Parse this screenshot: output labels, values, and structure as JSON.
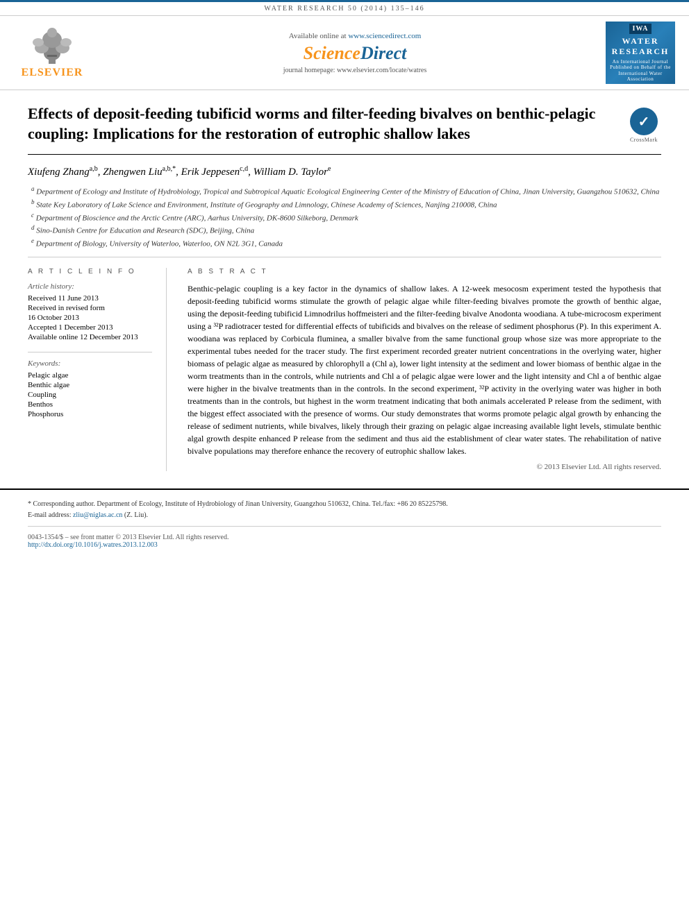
{
  "journal_bar": {
    "text": "WATER RESEARCH 50 (2014) 135–146"
  },
  "header": {
    "available_text": "Available online at",
    "sciencedirect_url": "www.sciencedirect.com",
    "sciencedirect_brand": "ScienceDirect",
    "journal_homepage_label": "journal homepage:",
    "journal_homepage_url": "www.elsevier.com/locate/watres",
    "elsevier_text": "ELSEVIER",
    "water_research": {
      "badge": "IWA",
      "title": "WATER RESEARCH",
      "subtitle": "An International Journal Published on Behalf of the International Water Association"
    }
  },
  "article": {
    "title": "Effects of deposit-feeding tubificid worms and filter-feeding bivalves on benthic-pelagic coupling: Implications for the restoration of eutrophic shallow lakes",
    "crossmark_label": "CrossMark"
  },
  "authors": {
    "line": "Xiufeng Zhang a,b, Zhengwen Liu a,b,*, Erik Jeppesen c,d, William D. Taylor e",
    "list": [
      {
        "name": "Xiufeng Zhang",
        "sup": "a,b"
      },
      {
        "name": "Zhengwen Liu",
        "sup": "a,b,*"
      },
      {
        "name": "Erik Jeppesen",
        "sup": "c,d"
      },
      {
        "name": "William D. Taylor",
        "sup": "e"
      }
    ]
  },
  "affiliations": [
    {
      "sup": "a",
      "text": "Department of Ecology and Institute of Hydrobiology, Tropical and Subtropical Aquatic Ecological Engineering Center of the Ministry of Education of China, Jinan University, Guangzhou 510632, China"
    },
    {
      "sup": "b",
      "text": "State Key Laboratory of Lake Science and Environment, Institute of Geography and Limnology, Chinese Academy of Sciences, Nanjing 210008, China"
    },
    {
      "sup": "c",
      "text": "Department of Bioscience and the Arctic Centre (ARC), Aarhus University, DK-8600 Silkeborg, Denmark"
    },
    {
      "sup": "d",
      "text": "Sino-Danish Centre for Education and Research (SDC), Beijing, China"
    },
    {
      "sup": "e",
      "text": "Department of Biology, University of Waterloo, Waterloo, ON N2L 3G1, Canada"
    }
  ],
  "article_info": {
    "col_heading": "A R T I C L E  I N F O",
    "history_label": "Article history:",
    "history_items": [
      "Received 11 June 2013",
      "Received in revised form",
      "16 October 2013",
      "Accepted 1 December 2013",
      "Available online 12 December 2013"
    ],
    "keywords_label": "Keywords:",
    "keywords": [
      "Pelagic algae",
      "Benthic algae",
      "Coupling",
      "Benthos",
      "Phosphorus"
    ]
  },
  "abstract": {
    "col_heading": "A B S T R A C T",
    "text": "Benthic-pelagic coupling is a key factor in the dynamics of shallow lakes. A 12-week mesocosm experiment tested the hypothesis that deposit-feeding tubificid worms stimulate the growth of pelagic algae while filter-feeding bivalves promote the growth of benthic algae, using the deposit-feeding tubificid Limnodrilus hoffmeisteri and the filter-feeding bivalve Anodonta woodiana. A tube-microcosm experiment using a ³²P radiotracer tested for differential effects of tubificids and bivalves on the release of sediment phosphorus (P). In this experiment A. woodiana was replaced by Corbicula fluminea, a smaller bivalve from the same functional group whose size was more appropriate to the experimental tubes needed for the tracer study. The first experiment recorded greater nutrient concentrations in the overlying water, higher biomass of pelagic algae as measured by chlorophyll a (Chl a), lower light intensity at the sediment and lower biomass of benthic algae in the worm treatments than in the controls, while nutrients and Chl a of pelagic algae were lower and the light intensity and Chl a of benthic algae were higher in the bivalve treatments than in the controls. In the second experiment, ³²P activity in the overlying water was higher in both treatments than in the controls, but highest in the worm treatment indicating that both animals accelerated P release from the sediment, with the biggest effect associated with the presence of worms. Our study demonstrates that worms promote pelagic algal growth by enhancing the release of sediment nutrients, while bivalves, likely through their grazing on pelagic algae increasing available light levels, stimulate benthic algal growth despite enhanced P release from the sediment and thus aid the establishment of clear water states. The rehabilitation of native bivalve populations may therefore enhance the recovery of eutrophic shallow lakes.",
    "copyright": "© 2013 Elsevier Ltd. All rights reserved."
  },
  "footer": {
    "corresponding_note": "* Corresponding author. Department of Ecology, Institute of Hydrobiology of Jinan University, Guangzhou 510632, China. Tel./fax: +86 20 85225798.",
    "email_label": "E-mail address:",
    "email": "zliu@niglas.ac.cn",
    "email_name": "(Z. Liu).",
    "issn_line": "0043-1354/$ – see front matter © 2013 Elsevier Ltd. All rights reserved.",
    "doi_text": "http://dx.doi.org/10.1016/j.watres.2013.12.003",
    "doi_url": "http://dx.doi.org/10.1016/j.watres.2013.12.003"
  }
}
